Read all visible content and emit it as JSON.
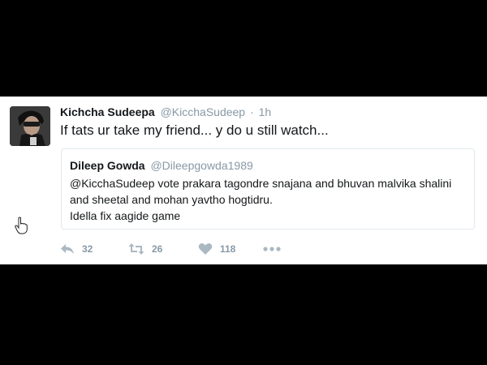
{
  "tweet": {
    "author_name": "Kichcha Sudeepa",
    "author_handle": "@KicchaSudeep",
    "separator": "·",
    "time": "1h",
    "text": "If tats ur take my friend... y do u still watch..."
  },
  "quoted_tweet": {
    "author_name": "Dileep Gowda",
    "author_handle": "@Dileepgowda1989",
    "text_lines": [
      "@KicchaSudeep vote prakara tagondre snajana and bhuvan malvika shalini",
      "and sheetal and mohan yavtho hogtidru.",
      "Idella fix aagide game"
    ]
  },
  "actions": {
    "reply_count": "32",
    "retweet_count": "26",
    "like_count": "118"
  },
  "icons": {
    "reply": "reply-icon",
    "retweet": "retweet-icon",
    "like": "heart-icon",
    "more": "more-icon",
    "cursor": "hand-cursor-icon"
  },
  "colors": {
    "background": "#000000",
    "card": "#ffffff",
    "text": "#14171a",
    "muted": "#8899a6",
    "icon": "#aab8c2",
    "border": "#e1e8ed"
  }
}
